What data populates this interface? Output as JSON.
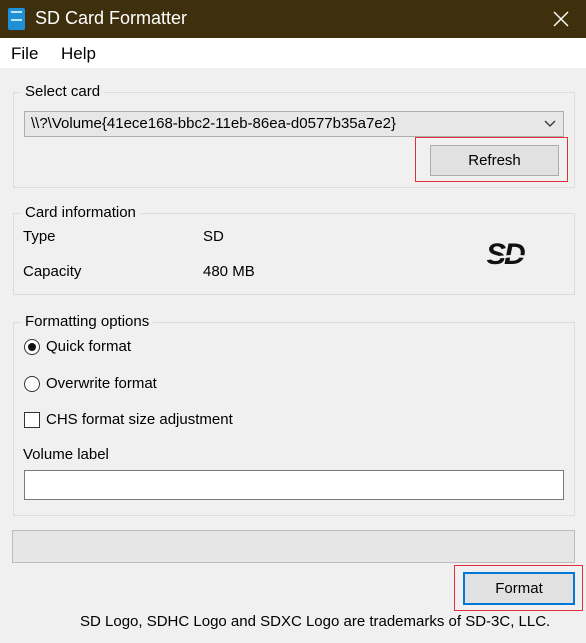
{
  "window": {
    "title": "SD Card Formatter"
  },
  "menu": {
    "file": "File",
    "help": "Help"
  },
  "select_card": {
    "group_label": "Select card",
    "selected_value": "\\\\?\\Volume{41ece168-bbc2-11eb-86ea-d0577b35a7e2}",
    "refresh_label": "Refresh"
  },
  "card_info": {
    "group_label": "Card information",
    "type_label": "Type",
    "type_value": "SD",
    "capacity_label": "Capacity",
    "capacity_value": "480 MB",
    "logo_text": "SD"
  },
  "formatting": {
    "group_label": "Formatting options",
    "quick_label": "Quick format",
    "quick_checked": true,
    "overwrite_label": "Overwrite format",
    "overwrite_checked": false,
    "chs_label": "CHS format size adjustment",
    "chs_checked": false,
    "volume_label_caption": "Volume label",
    "volume_label_value": ""
  },
  "progress": {
    "fraction": 0
  },
  "format_button": "Format",
  "footer": "SD Logo, SDHC Logo and SDXC Logo are trademarks of SD-3C, LLC.",
  "colors": {
    "titlebar": "#3f300d",
    "highlight": "#e0303a",
    "accent_border": "#0078d7"
  },
  "icons": [
    "app-sd-card-icon",
    "close-icon",
    "chevron-down-icon",
    "sd-logo-icon"
  ]
}
